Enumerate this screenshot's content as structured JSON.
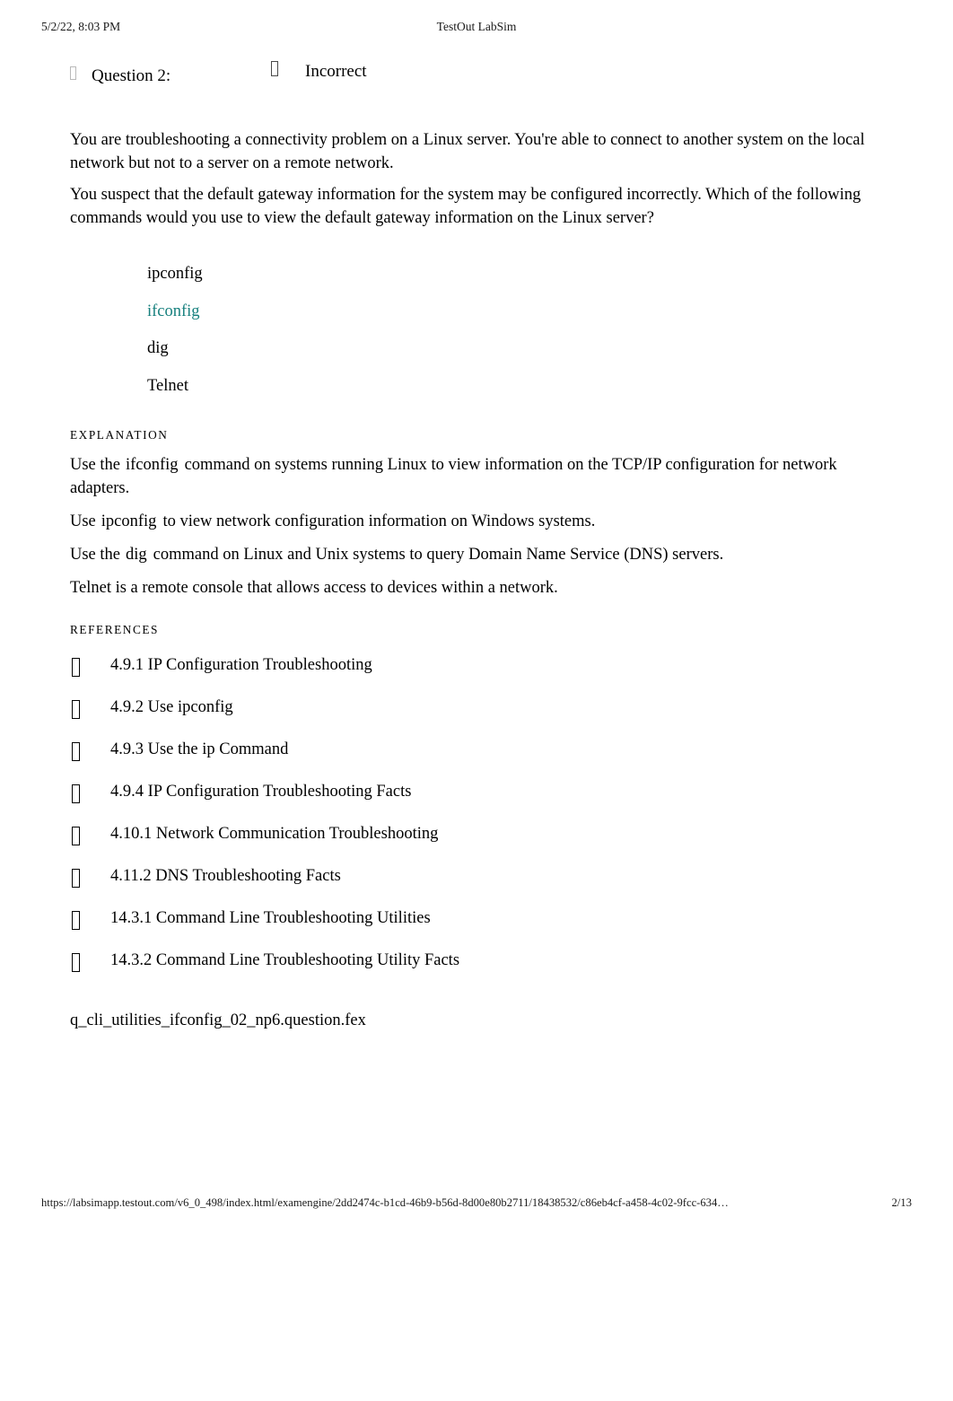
{
  "page_header": {
    "date": "5/2/22, 8:03 PM",
    "title": "TestOut LabSim",
    "tofu_icon": "missing-glyph-box-icon"
  },
  "question": {
    "label": "Question 2:",
    "status": "Incorrect",
    "label_tofu_icon": "missing-glyph-box-icon",
    "status_tofu_icon": "missing-glyph-box-icon",
    "paragraphs": [
      "You are troubleshooting a connectivity problem on a Linux server. You're able to connect to another system on the local network but not to a server on a remote network.",
      "You suspect that the default gateway information for the system may be configured incorrectly. Which of the following commands would you use to view the default gateway information on the Linux server?"
    ]
  },
  "options": [
    {
      "label": "ipconfig",
      "correct": false
    },
    {
      "label": "ifconfig",
      "correct": true
    },
    {
      "label": "dig",
      "correct": false
    },
    {
      "label": "Telnet",
      "correct": false
    }
  ],
  "explanation": {
    "heading": "EXPLANATION",
    "paragraphs": [
      {
        "before": "Use the",
        "cmd": "ifconfig",
        "after": "command on systems running Linux to view information on the TCP/IP configuration for network adapters."
      },
      {
        "before": "Use",
        "cmd": "ipconfig",
        "after": "to view network configuration information on Windows systems."
      },
      {
        "before": "Use the",
        "cmd": "dig",
        "after": "command on Linux and Unix systems to query Domain Name Service (DNS) servers."
      },
      {
        "before": "Telnet is a remote console that allows access to devices within a network.",
        "cmd": "",
        "after": ""
      }
    ]
  },
  "references": {
    "heading": "REFERENCES",
    "bullet_icon": "missing-glyph-box-icon",
    "items": [
      "4.9.1 IP Configuration Troubleshooting",
      "4.9.2 Use ipconfig",
      "4.9.3 Use the ip Command",
      "4.9.4 IP Configuration Troubleshooting Facts",
      "4.10.1 Network Communication Troubleshooting",
      "4.11.2 DNS Troubleshooting Facts",
      "14.3.1 Command Line Troubleshooting Utilities",
      "14.3.2 Command Line Troubleshooting Utility Facts"
    ]
  },
  "source_file": "q_cli_utilities_ifconfig_02_np6.question.fex",
  "page_footer": {
    "url": "https://labsimapp.testout.com/v6_0_498/index.html/examengine/2dd2474c-b1cd-46b9-b56d-8d00e80b2711/18438532/c86eb4cf-a458-4c02-9fcc-634…",
    "page_number": "2/13"
  },
  "colors": {
    "correct_answer_teal": "#17807e",
    "text_black": "#000000",
    "tofu_light": "#b9b9b9"
  }
}
